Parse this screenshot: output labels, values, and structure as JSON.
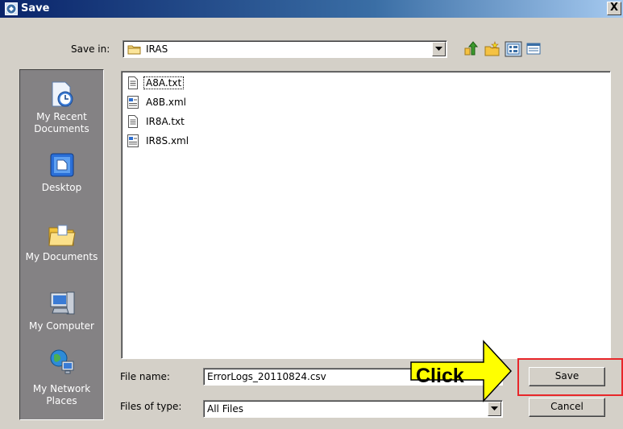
{
  "window": {
    "title": "Save",
    "close_label": "X"
  },
  "save_in": {
    "label": "Save in:",
    "value": "IRAS"
  },
  "toolbar_icons": [
    "up-folder-icon",
    "new-folder-icon",
    "list-view-icon",
    "details-view-icon"
  ],
  "places": [
    {
      "label": "My Recent Documents",
      "icon": "recent-documents-icon"
    },
    {
      "label": "Desktop",
      "icon": "desktop-icon"
    },
    {
      "label": "My Documents",
      "icon": "my-documents-icon"
    },
    {
      "label": "My Computer",
      "icon": "my-computer-icon"
    },
    {
      "label": "My Network Places",
      "icon": "network-places-icon"
    }
  ],
  "files": [
    {
      "name": "A8A.txt",
      "type": "txt"
    },
    {
      "name": "A8B.xml",
      "type": "xml"
    },
    {
      "name": "IR8A.txt",
      "type": "txt"
    },
    {
      "name": "IR8S.xml",
      "type": "xml"
    }
  ],
  "file_name": {
    "label": "File name:",
    "value": "ErrorLogs_20110824.csv"
  },
  "file_type": {
    "label": "Files of type:",
    "value": "All Files"
  },
  "buttons": {
    "save": "Save",
    "cancel": "Cancel"
  },
  "annotation": {
    "text": "Click",
    "arrow_color": "#ffff00",
    "highlight_color": "#e8262a"
  }
}
